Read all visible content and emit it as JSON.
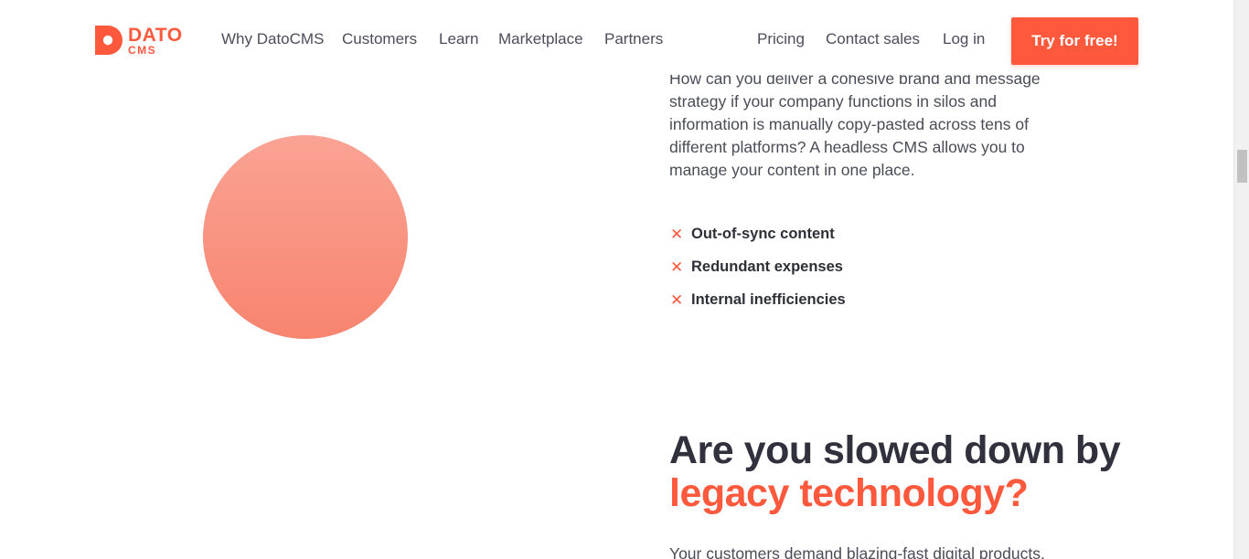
{
  "header": {
    "logo": {
      "line1": "DATO",
      "line2": "CMS"
    },
    "nav_left": [
      "Why DatoCMS",
      "Customers",
      "Learn",
      "Marketplace",
      "Partners"
    ],
    "nav_right": [
      "Pricing",
      "Contact sales",
      "Log in"
    ],
    "cta_label": "Try for free!"
  },
  "section_silos": {
    "paragraph": "How can you deliver a cohesive brand and message strategy if your company functions in silos and information is manually copy-pasted across tens of different platforms? A headless CMS allows you to manage your content in one place.",
    "features": [
      "Out-of-sync content",
      "Redundant expenses",
      "Internal inefficiencies"
    ],
    "feature_icon": "x-icon"
  },
  "section_legacy": {
    "heading_line1": "Are you slowed down by",
    "heading_accent": "legacy technology?",
    "intro": "Your customers demand blazing-fast digital products."
  },
  "colors": {
    "accent": "#ff593d",
    "text_dark": "#30313c",
    "circle_top": "#faa394",
    "circle_bottom": "#f7846f"
  }
}
